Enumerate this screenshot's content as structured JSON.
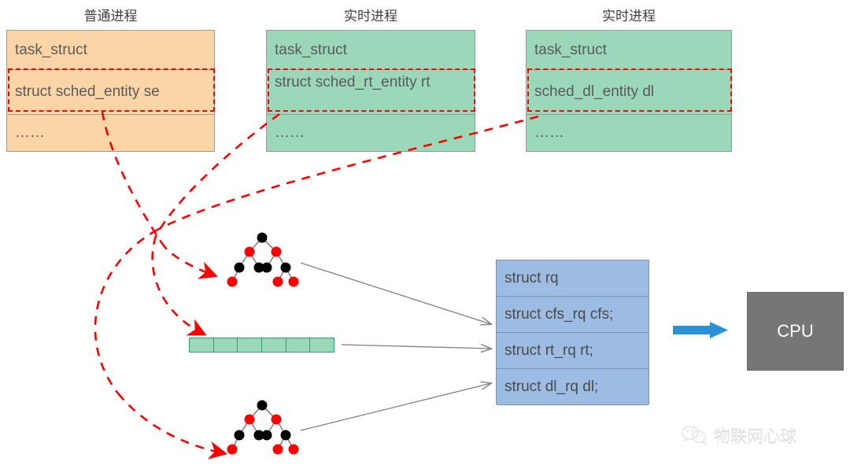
{
  "columns": [
    {
      "title": "普通进程",
      "kind": "normal-process",
      "color": "#fbd5a5",
      "rows": [
        "task_struct",
        "struct sched_entity se",
        "……"
      ],
      "highlight_row_index": 1
    },
    {
      "title": "实时进程",
      "kind": "realtime-process",
      "color": "#9ad8b9",
      "rows": [
        "task_struct",
        "struct sched_rt_entity rt",
        "……"
      ],
      "highlight_row_index": 1
    },
    {
      "title": "实时进程",
      "kind": "deadline-process",
      "color": "#9ad8b9",
      "rows": [
        "task_struct",
        "sched_dl_entity dl",
        "……"
      ],
      "highlight_row_index": 1
    }
  ],
  "runqueue": {
    "color": "#9dbce3",
    "rows": [
      "struct rq",
      "struct cfs_rq cfs;",
      "struct rt_rq rt;",
      "struct dl_rq dl;"
    ]
  },
  "cpu": {
    "label": "CPU",
    "color": "#767676"
  },
  "arrow": {
    "color": "#2a91d8"
  },
  "structures": {
    "cfs_rbtree_label": "red-black-tree",
    "rt_array_cells": 6,
    "dl_rbtree_label": "red-black-tree"
  },
  "colors": {
    "highlight": "#ff0000",
    "connector": "#808080",
    "orange_fill": "#fbd5a5",
    "green_fill": "#9ad8b9",
    "blue_fill": "#9dbce3",
    "node_red": "#ff0000",
    "node_black": "#000000"
  },
  "watermark": {
    "icon": "wechat-icon",
    "text": "物联网心球"
  }
}
